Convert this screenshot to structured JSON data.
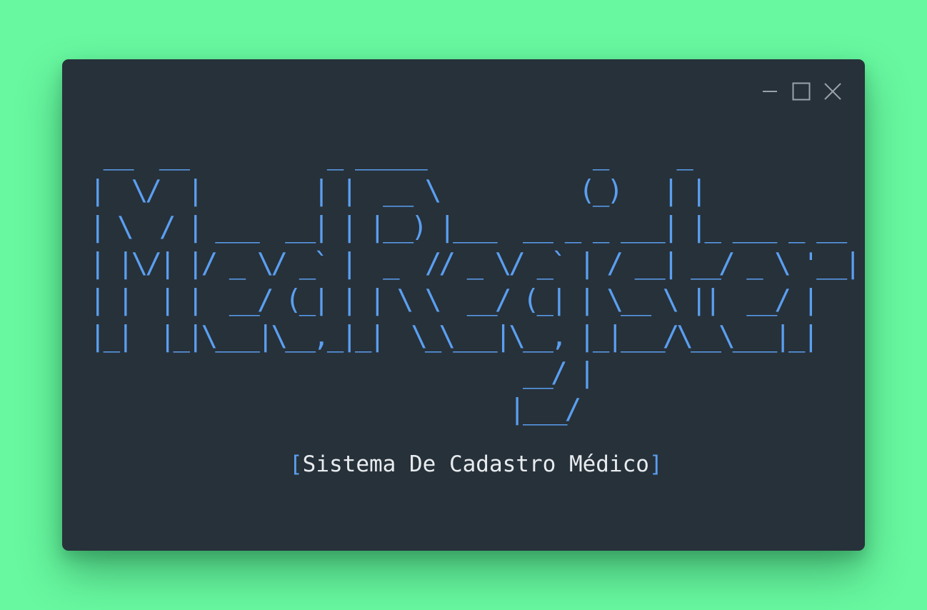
{
  "window": {
    "controls": {
      "minimize_icon": "minimize-icon",
      "maximize_icon": "maximize-icon",
      "close_icon": "close-icon"
    }
  },
  "banner": {
    "lines": [
      " __  __          _ _____            _     _",
      "|  \\/  |        | |  __ \\          (_)   | |",
      "| \\  / | ___  __| | |__) |___  __ _ _ ___| |_ ___ _ __",
      "| |\\/| |/ _ \\/ _` |  _  // _ \\/ _` | / __| __/ _ \\ '__|",
      "| |  | |  __/ (_| | | \\ \\  __/ (_| | \\__ \\ ||  __/ |",
      "|_|  |_|\\___|\\__,_|_|  \\_\\___|\\__, |_|___/\\__\\___|_|",
      "                               __/ |",
      "                              |___/"
    ],
    "color": "#5b9ff0"
  },
  "subtitle": {
    "open_bracket": "[",
    "text": "Sistema De Cadastro Médico",
    "close_bracket": "]"
  },
  "colors": {
    "background": "#68f8a0",
    "window": "#27313a",
    "accent": "#5b9ff0",
    "text": "#e8ecef"
  }
}
